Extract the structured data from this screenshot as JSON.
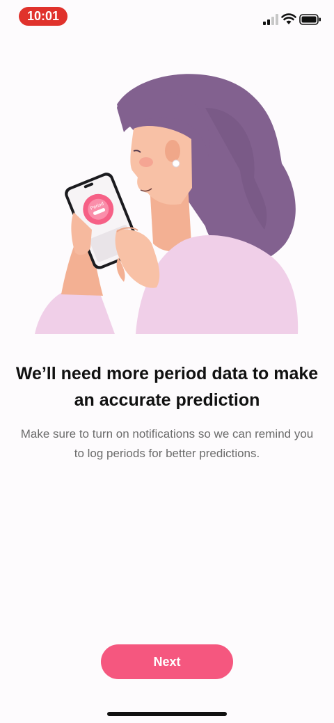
{
  "status_bar": {
    "time": "10:01",
    "signal_icon": "cellular-signal-icon",
    "wifi_icon": "wifi-icon",
    "battery_icon": "battery-icon"
  },
  "illustration": {
    "subject": "woman-holding-phone",
    "phone_screen_label": "Period"
  },
  "onboarding": {
    "headline": "We’ll need more period data to make an accurate prediction",
    "body": "Make sure to turn on notifications so we can remind you to log periods for better predictions."
  },
  "actions": {
    "next_label": "Next"
  },
  "colors": {
    "accent": "#f5577f",
    "time_pill": "#e0322c",
    "hair": "#82618f",
    "sweater": "#f0cfe8",
    "skin": "#f6b99e",
    "background": "#fdfbfd"
  }
}
